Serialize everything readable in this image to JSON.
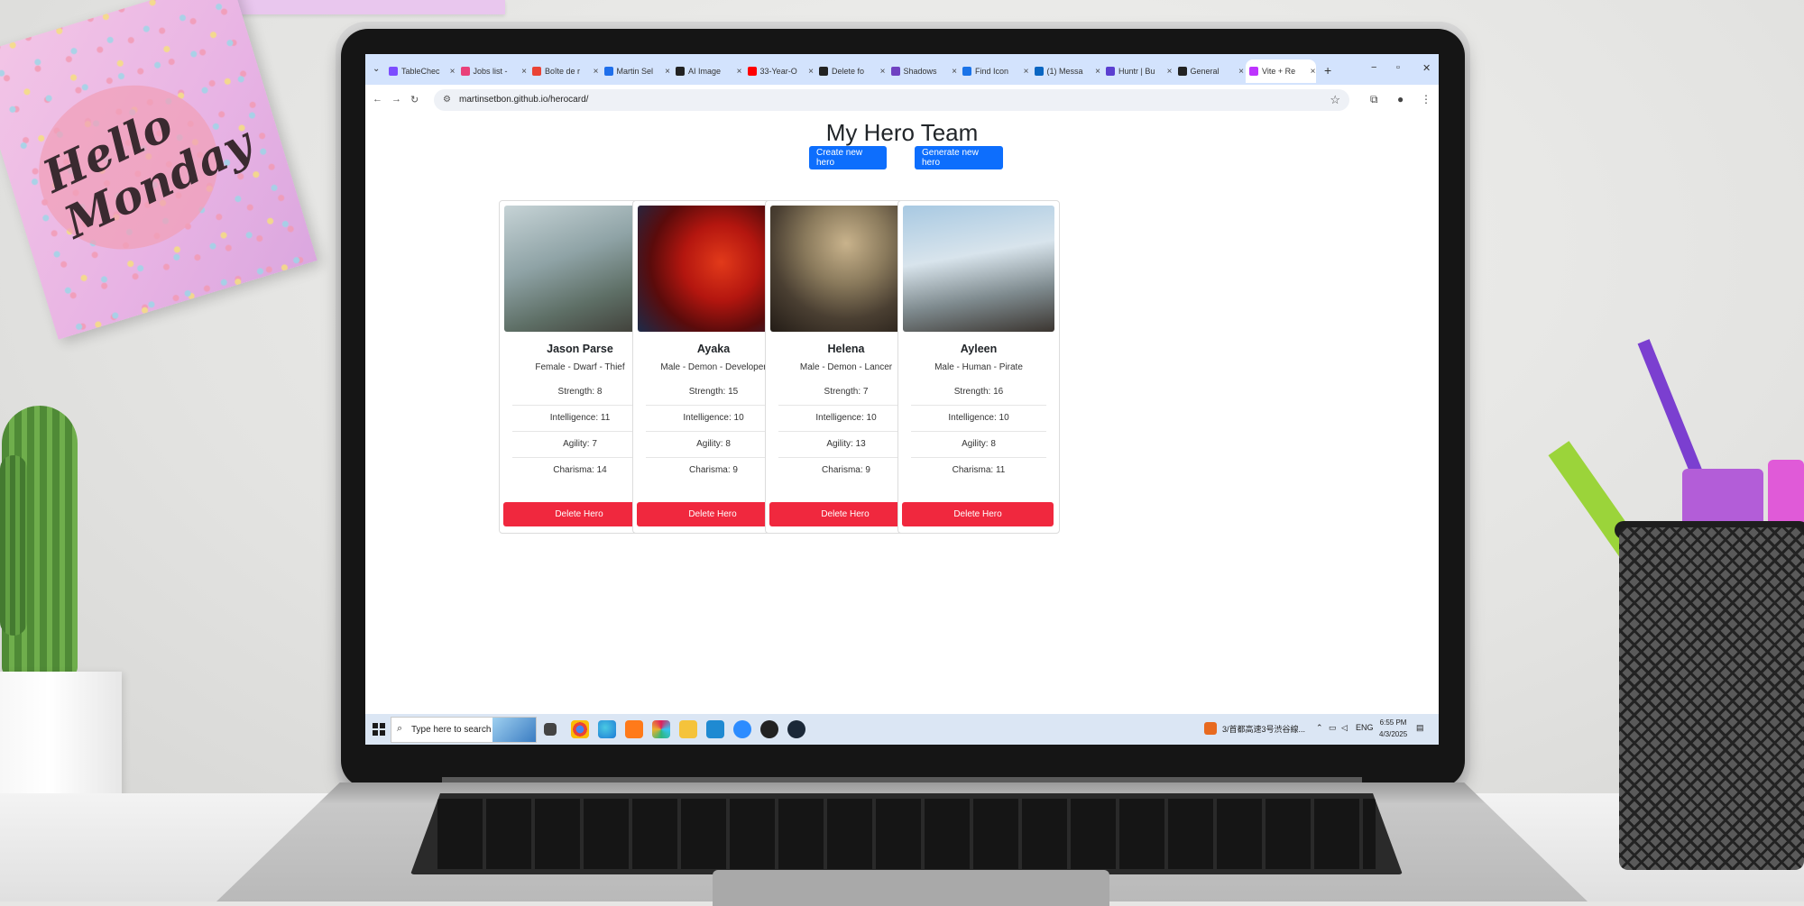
{
  "decor": {
    "sticky_note_text": "Hello Monday"
  },
  "browser": {
    "tabs": [
      {
        "label": "TableChec",
        "favicon": "purple"
      },
      {
        "label": "Jobs list -",
        "favicon": "pink"
      },
      {
        "label": "Boîte de r",
        "favicon": "gmail"
      },
      {
        "label": "Martin Sel",
        "favicon": "blue-w"
      },
      {
        "label": "AI Image",
        "favicon": "dark"
      },
      {
        "label": "33-Year-O",
        "favicon": "youtube-red"
      },
      {
        "label": "Delete fo",
        "favicon": "github"
      },
      {
        "label": "Shadows",
        "favicon": "purple-b"
      },
      {
        "label": "Find Icon",
        "favicon": "blue"
      },
      {
        "label": "(1) Messa",
        "favicon": "linkedin"
      },
      {
        "label": "Huntr | Bu",
        "favicon": "purple-h"
      },
      {
        "label": "General",
        "favicon": "github"
      },
      {
        "label": "Vite + Re",
        "favicon": "vite"
      }
    ],
    "new_tab_label": "+",
    "address_url": "martinsetbon.github.io/herocard/",
    "window_controls": {
      "minimize": "−",
      "maximize": "▫",
      "close": "✕"
    }
  },
  "page": {
    "title": "My Hero Team",
    "create_button": "Create new hero",
    "generate_button": "Generate new hero",
    "delete_label": "Delete Hero",
    "heroes": [
      {
        "name": "Jason Parse",
        "subtitle": "Female - Dwarf - Thief",
        "strength": "Strength: 8",
        "intelligence": "Intelligence: 11",
        "agility": "Agility: 7",
        "charisma": "Charisma: 14"
      },
      {
        "name": "Ayaka",
        "subtitle": "Male - Demon - Developer",
        "strength": "Strength: 15",
        "intelligence": "Intelligence: 10",
        "agility": "Agility: 8",
        "charisma": "Charisma: 9"
      },
      {
        "name": "Helena",
        "subtitle": "Male - Demon - Lancer",
        "strength": "Strength: 7",
        "intelligence": "Intelligence: 10",
        "agility": "Agility: 13",
        "charisma": "Charisma: 9"
      },
      {
        "name": "Ayleen",
        "subtitle": "Male - Human - Pirate",
        "strength": "Strength: 16",
        "intelligence": "Intelligence: 10",
        "agility": "Agility: 8",
        "charisma": "Charisma: 11"
      }
    ]
  },
  "taskbar": {
    "search_placeholder": "Type here to search",
    "weather_text": "3/首都高速3号渋谷線...",
    "language": "ENG",
    "time": "6:55 PM",
    "date": "4/3/2025"
  },
  "colors": {
    "primary_button": "#0d6efd",
    "danger_button": "#f0283e",
    "tabstrip": "#d3e3fd"
  }
}
